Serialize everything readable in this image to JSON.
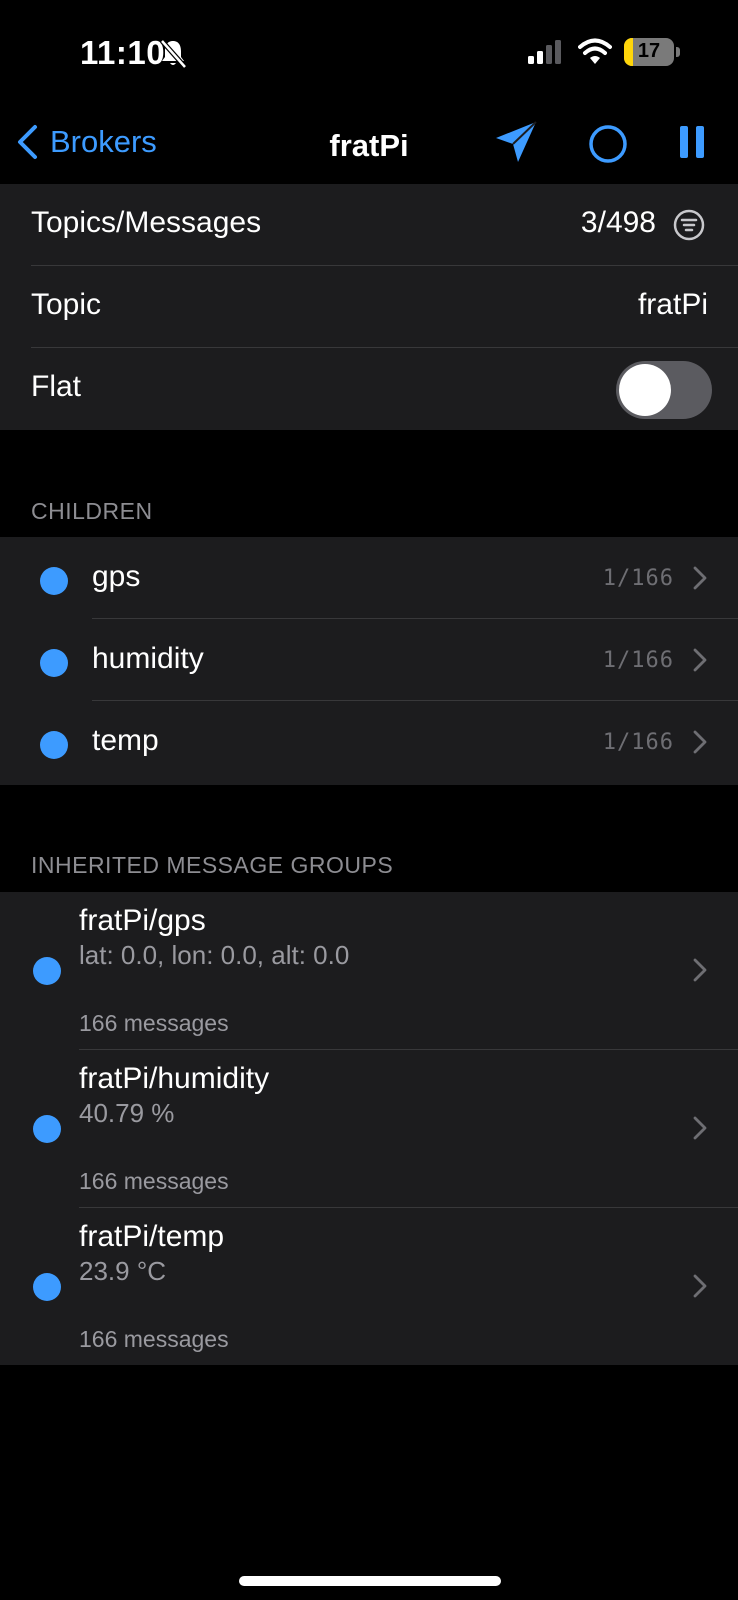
{
  "status_bar": {
    "time": "11:10",
    "battery": "17",
    "battery_level": 0.17
  },
  "nav": {
    "back_label": "Brokers",
    "title": "fratPi"
  },
  "info": {
    "topics_messages_label": "Topics/Messages",
    "topics_messages_value": "3/498",
    "topic_label": "Topic",
    "topic_value": "fratPi",
    "flat_label": "Flat",
    "flat_on": false
  },
  "children": {
    "header": "CHILDREN",
    "items": [
      {
        "label": "gps",
        "count": "1/166"
      },
      {
        "label": "humidity",
        "count": "1/166"
      },
      {
        "label": "temp",
        "count": "1/166"
      }
    ]
  },
  "inherited": {
    "header": "INHERITED MESSAGE GROUPS",
    "items": [
      {
        "topic": "fratPi/gps",
        "value": "lat: 0.0, lon: 0.0, alt: 0.0",
        "messages": "166 messages"
      },
      {
        "topic": "fratPi/humidity",
        "value": "40.79 %",
        "messages": "166 messages"
      },
      {
        "topic": "fratPi/temp",
        "value": "23.9 °C",
        "messages": "166 messages"
      }
    ]
  },
  "colors": {
    "accent": "#3d9bff",
    "cell_bg": "#1c1c1e",
    "background": "#000000"
  }
}
